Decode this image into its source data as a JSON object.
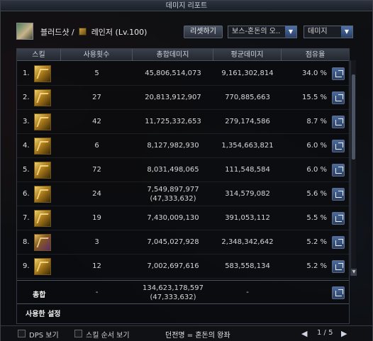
{
  "window": {
    "title": "데미지 리포트"
  },
  "header": {
    "character_name": "블러드샷 /",
    "job_name": "레인저 (Lv.100)",
    "reset_label": "리셋하기",
    "boss_select": "보스-혼돈의 오..",
    "metric_select": "데미지"
  },
  "table": {
    "columns": [
      "스킬",
      "사용횟수",
      "총합데미지",
      "평균데미지",
      "점유율"
    ],
    "rows": [
      {
        "rank": "1.",
        "count": "5",
        "total": "45,806,514,073",
        "total_sub": "",
        "avg": "9,161,302,814",
        "share": "34.0 %"
      },
      {
        "rank": "2.",
        "count": "27",
        "total": "20,813,912,907",
        "total_sub": "",
        "avg": "770,885,663",
        "share": "15.5 %"
      },
      {
        "rank": "3.",
        "count": "42",
        "total": "11,725,332,653",
        "total_sub": "",
        "avg": "279,174,586",
        "share": "8.7 %"
      },
      {
        "rank": "4.",
        "count": "6",
        "total": "8,127,982,930",
        "total_sub": "",
        "avg": "1,354,663,821",
        "share": "6.0 %"
      },
      {
        "rank": "5.",
        "count": "72",
        "total": "8,031,498,065",
        "total_sub": "",
        "avg": "111,548,584",
        "share": "6.0 %"
      },
      {
        "rank": "6.",
        "count": "24",
        "total": "7,549,897,977",
        "total_sub": "(47,333,632)",
        "avg": "314,579,082",
        "share": "5.6 %"
      },
      {
        "rank": "7.",
        "count": "19",
        "total": "7,430,009,130",
        "total_sub": "",
        "avg": "391,053,112",
        "share": "5.5 %"
      },
      {
        "rank": "8.",
        "count": "3",
        "total": "7,045,027,928",
        "total_sub": "",
        "avg": "2,348,342,642",
        "share": "5.2 %"
      },
      {
        "rank": "9.",
        "count": "12",
        "total": "7,002,697,616",
        "total_sub": "",
        "avg": "583,558,134",
        "share": "5.2 %"
      }
    ],
    "summary": {
      "label": "총합",
      "count": "-",
      "total": "134,623,178,597",
      "total_sub": "(47,333,632)",
      "avg": "-"
    },
    "settings_label": "사용한 설정"
  },
  "footer": {
    "dps_label": "DPS 보기",
    "skill_order_label": "스킬 순서 보기",
    "dungeon": "던전명 = 혼돈의 왕좌",
    "page": "1 / 5",
    "prev": "◀",
    "next": "▶"
  }
}
